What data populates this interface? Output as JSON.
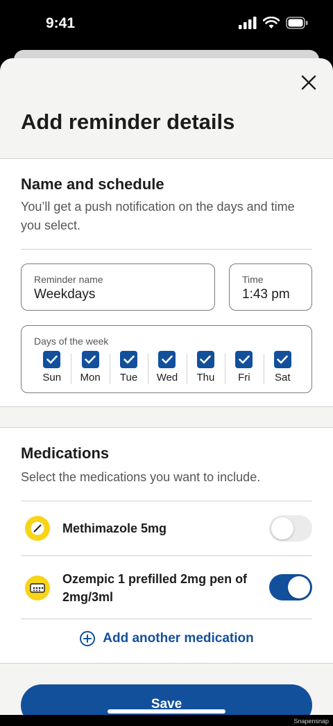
{
  "status_bar": {
    "time": "9:41"
  },
  "sheet": {
    "title": "Add reminder details"
  },
  "schedule": {
    "heading": "Name and schedule",
    "description": "You’ll get a push notification on the days and time you select.",
    "reminder_name": {
      "label": "Reminder name",
      "value": "Weekdays"
    },
    "time": {
      "label": "Time",
      "value": "1:43 pm"
    },
    "days_label": "Days of the week",
    "days": [
      {
        "name": "Sun",
        "checked": true
      },
      {
        "name": "Mon",
        "checked": true
      },
      {
        "name": "Tue",
        "checked": true
      },
      {
        "name": "Wed",
        "checked": true
      },
      {
        "name": "Thu",
        "checked": true
      },
      {
        "name": "Fri",
        "checked": true
      },
      {
        "name": "Sat",
        "checked": true
      }
    ]
  },
  "medications": {
    "heading": "Medications",
    "description": "Select the medications you want to include.",
    "items": [
      {
        "name": "Methimazole 5mg",
        "icon": "pill-icon",
        "enabled": false
      },
      {
        "name": "Ozempic 1 prefilled 2mg pen of 2mg/3ml",
        "icon": "pen-injector-icon",
        "enabled": true
      }
    ],
    "add_label": "Add another medication"
  },
  "footer": {
    "save_label": "Save",
    "watermark": "Snapensnap"
  },
  "colors": {
    "accent": "#13509c",
    "pill_badge": "#f7d417",
    "sheet_bg": "#f4f4f2"
  }
}
